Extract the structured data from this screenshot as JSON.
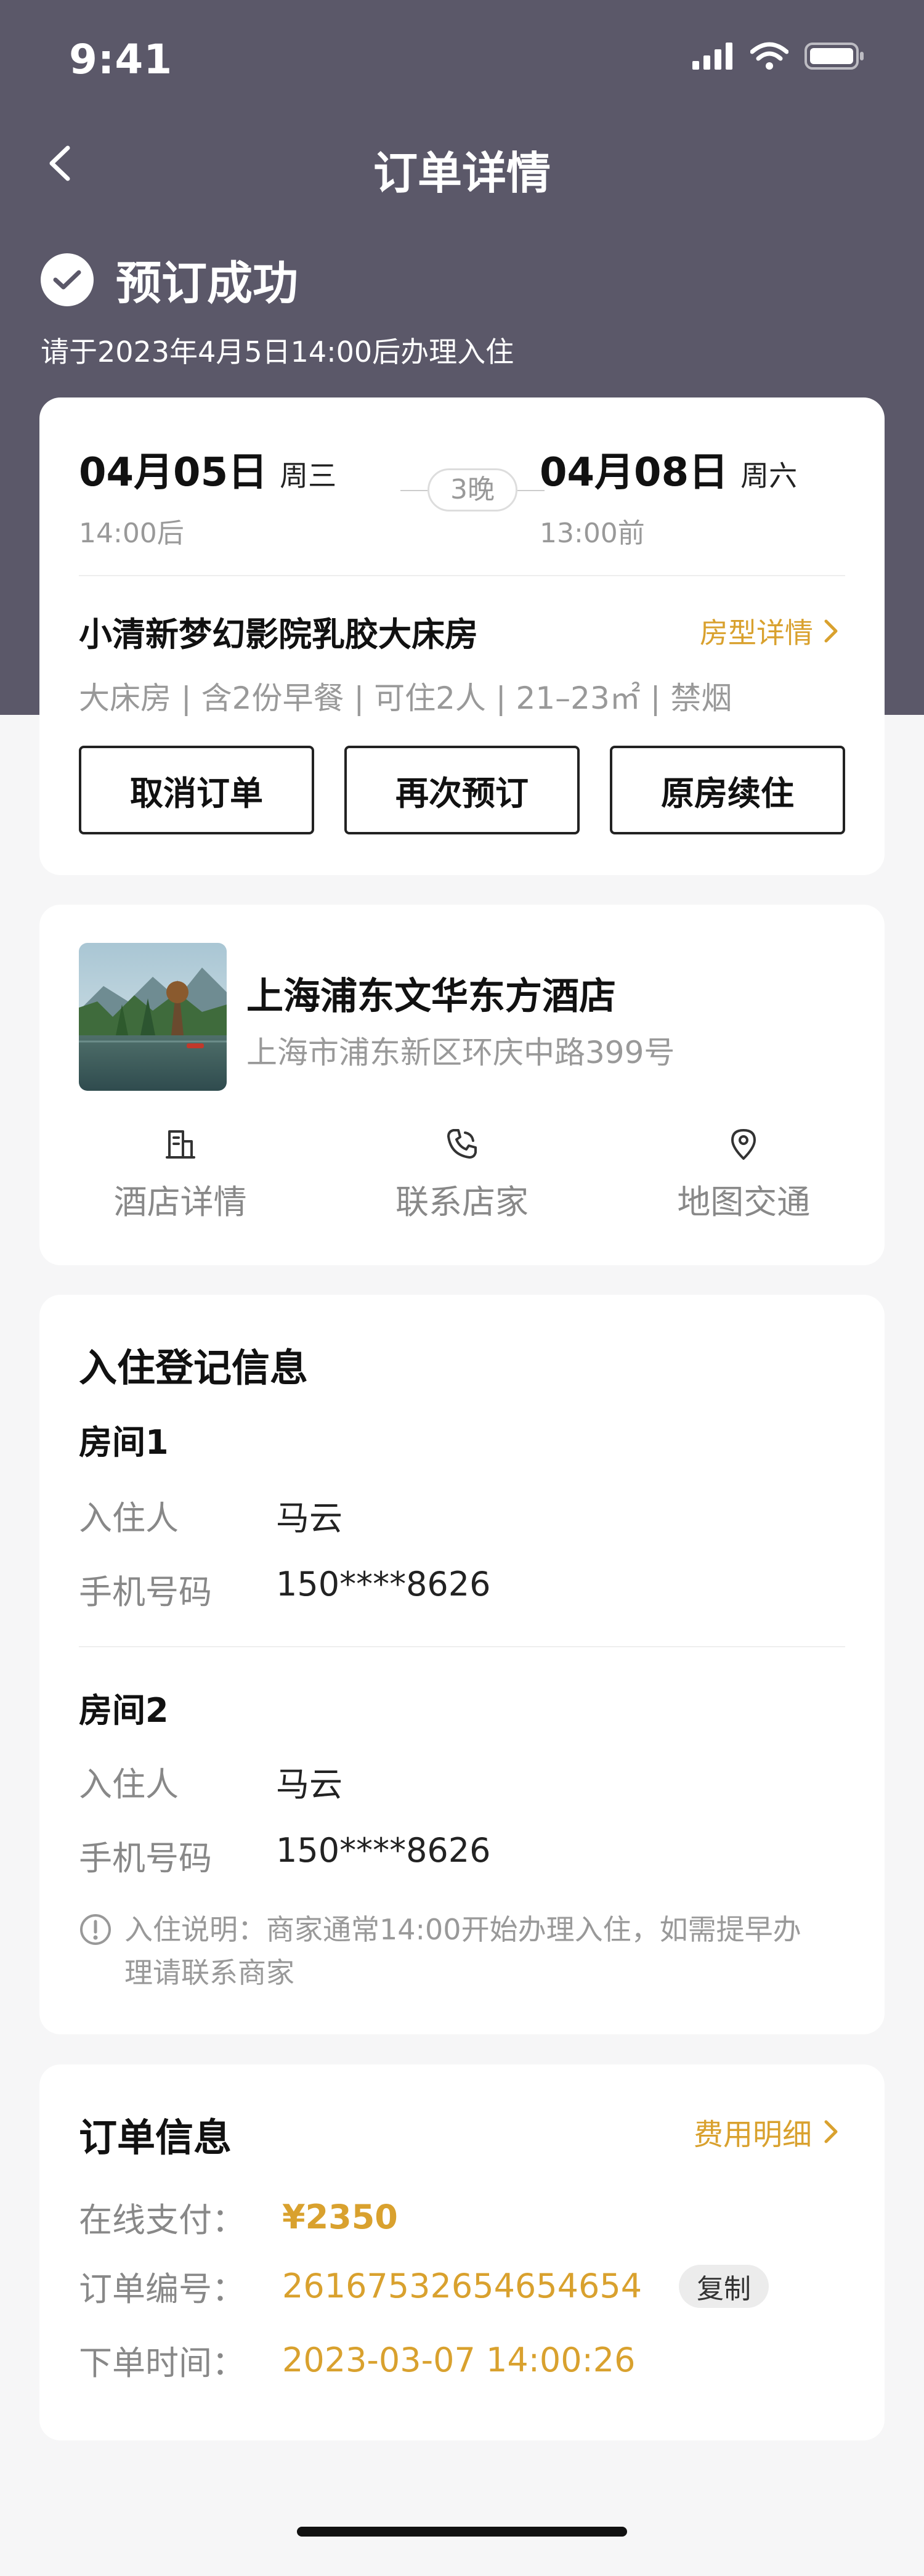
{
  "status_bar": {
    "time": "9:41"
  },
  "nav": {
    "title": "订单详情"
  },
  "booking": {
    "status": "预订成功",
    "checkin_hint": "请于2023年4月5日14:00后办理入住"
  },
  "stay": {
    "checkin": {
      "date": "04月05日",
      "weekday": "周三",
      "time": "14:00后"
    },
    "checkout": {
      "date": "04月08日",
      "weekday": "周六",
      "time": "13:00前"
    },
    "nights": "3晚",
    "room_name": "小清新梦幻影院乳胶大床房",
    "room_detail_link": "房型详情",
    "room_meta": "大床房 | 含2份早餐 | 可住2人 | 21–23㎡ | 禁烟",
    "buttons": {
      "cancel": "取消订单",
      "rebook": "再次预订",
      "extend": "原房续住"
    }
  },
  "hotel": {
    "name": "上海浦东文华东方酒店",
    "address": "上海市浦东新区环庆中路399号",
    "actions": [
      {
        "label": "酒店详情",
        "icon": "building-doc-icon"
      },
      {
        "label": "联系店家",
        "icon": "phone-icon"
      },
      {
        "label": "地图交通",
        "icon": "map-pin-icon"
      }
    ]
  },
  "registration": {
    "title": "入住登记信息",
    "rooms": [
      {
        "title": "房间1",
        "guest_label": "入住人",
        "guest": "马云",
        "phone_label": "手机号码",
        "phone": "150****8626"
      },
      {
        "title": "房间2",
        "guest_label": "入住人",
        "guest": "马云",
        "phone_label": "手机号码",
        "phone": "150****8626"
      }
    ],
    "note_line1": "入住说明：商家通常14:00开始办理入住，如需提早办",
    "note_line2": "理请联系商家"
  },
  "order": {
    "title": "订单信息",
    "fee_link": "费用明细",
    "payment_label": "在线支付：",
    "payment": "¥2350",
    "number_label": "订单编号：",
    "number": "26167532654654654",
    "copy": "复制",
    "time_label": "下单时间：",
    "time": "2023-03-07 14:00:26"
  },
  "colors": {
    "header_bg": "#5b5869",
    "accent": "#d9a12e",
    "page_bg": "#f6f6f7"
  }
}
